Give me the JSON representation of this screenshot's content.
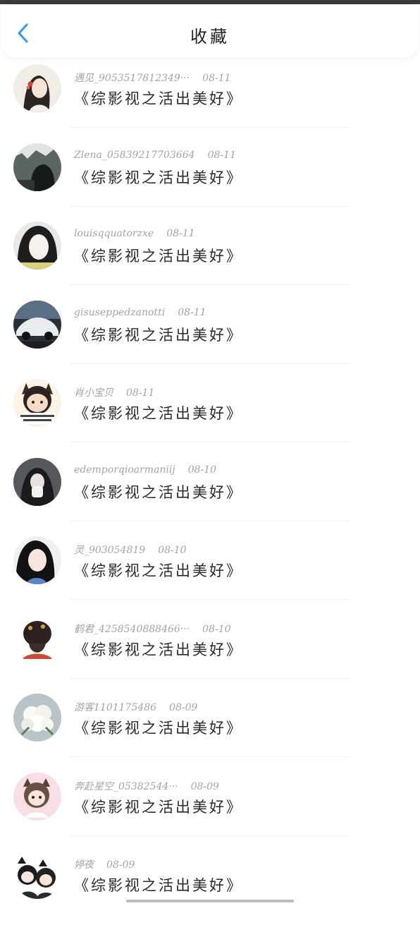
{
  "header": {
    "title": "收藏",
    "back_icon": "chevron-left-icon",
    "accent_color": "#2f9cf0"
  },
  "favorites": [
    {
      "user": "遇见_9053517812349···",
      "date": "08-11",
      "book": "《综影视之活出美好》"
    },
    {
      "user": "Zlena_05839217703664",
      "date": "08-11",
      "book": "《综影视之活出美好》"
    },
    {
      "user": "louisqquatorzxe",
      "date": "08-11",
      "book": "《综影视之活出美好》"
    },
    {
      "user": "gisuseppedzanotti",
      "date": "08-11",
      "book": "《综影视之活出美好》"
    },
    {
      "user": "肖小宝贝",
      "date": "08-11",
      "book": "《综影视之活出美好》"
    },
    {
      "user": "edemporqioarmaniij",
      "date": "08-10",
      "book": "《综影视之活出美好》"
    },
    {
      "user": "灵_903054819",
      "date": "08-10",
      "book": "《综影视之活出美好》"
    },
    {
      "user": "鹤君_4258540888466···",
      "date": "08-10",
      "book": "《综影视之活出美好》"
    },
    {
      "user": "游客1101175486",
      "date": "08-09",
      "book": "《综影视之活出美好》"
    },
    {
      "user": "奔赴星空_05382544···",
      "date": "08-09",
      "book": "《综影视之活出美好》"
    },
    {
      "user": "婷夜",
      "date": "08-09",
      "book": "《综影视之活出美好》"
    }
  ]
}
